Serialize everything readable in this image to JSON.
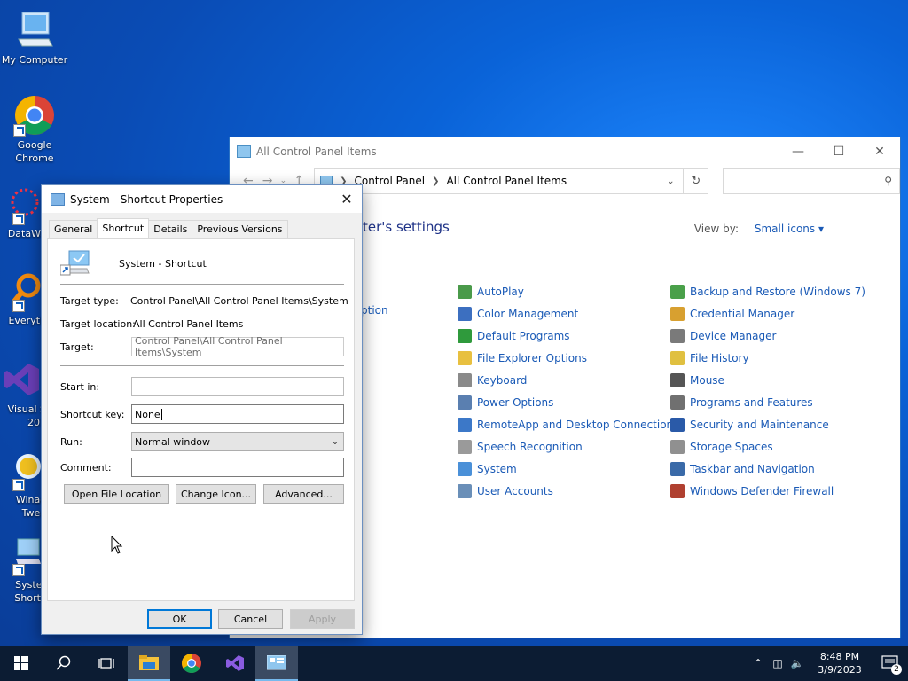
{
  "desktop": {
    "icons": [
      {
        "label": "My Computer",
        "icon": "monitor-icon"
      },
      {
        "label": "Google\nChrome",
        "icon": "chrome-icon"
      },
      {
        "label": "DataWa",
        "icon": "datawarrior-icon"
      },
      {
        "label": "Everyth",
        "icon": "everything-search-icon"
      },
      {
        "label": "Visual S\n201",
        "icon": "visual-studio-icon"
      },
      {
        "label": "Winae\nTwea",
        "icon": "winaero-tweaker-icon"
      },
      {
        "label": "Syster\nShortc",
        "icon": "system-shortcut-icon"
      }
    ]
  },
  "control_panel": {
    "title": "All Control Panel Items",
    "address": [
      "Control Panel",
      "All Control Panel Items"
    ],
    "heading": "ter's settings",
    "view_by_label": "View by:",
    "view_by_value": "Small icons",
    "partial_left": "ption",
    "columns": [
      [
        {
          "label": "AutoPlay",
          "color": "#4a9a4a"
        },
        {
          "label": "Color Management",
          "color": "#3c6fc0"
        },
        {
          "label": "Default Programs",
          "color": "#2f9a3c"
        },
        {
          "label": "File Explorer Options",
          "color": "#e8c040"
        },
        {
          "label": "Keyboard",
          "color": "#8a8a8a"
        },
        {
          "label": "Power Options",
          "color": "#5a7fb0"
        },
        {
          "label": "RemoteApp and Desktop Connections",
          "color": "#3c78c8"
        },
        {
          "label": "Speech Recognition",
          "color": "#9a9a9a"
        },
        {
          "label": "System",
          "color": "#4a90d8"
        },
        {
          "label": "User Accounts",
          "color": "#6a8fb8"
        }
      ],
      [
        {
          "label": "Backup and Restore (Windows 7)",
          "color": "#4aa04a"
        },
        {
          "label": "Credential Manager",
          "color": "#d8a030"
        },
        {
          "label": "Device Manager",
          "color": "#7a7a7a"
        },
        {
          "label": "File History",
          "color": "#e0c040"
        },
        {
          "label": "Mouse",
          "color": "#555555"
        },
        {
          "label": "Programs and Features",
          "color": "#707070"
        },
        {
          "label": "Security and Maintenance",
          "color": "#2a5aa8"
        },
        {
          "label": "Storage Spaces",
          "color": "#909090"
        },
        {
          "label": "Taskbar and Navigation",
          "color": "#3a6aa8"
        },
        {
          "label": "Windows Defender Firewall",
          "color": "#b04030"
        }
      ]
    ]
  },
  "dialog": {
    "title": "System - Shortcut Properties",
    "tabs": [
      "General",
      "Shortcut",
      "Details",
      "Previous Versions"
    ],
    "active_tab": "Shortcut",
    "name": "System - Shortcut",
    "target_type_label": "Target type:",
    "target_type_value": "Control Panel\\All Control Panel Items\\System",
    "target_location_label": "Target location:",
    "target_location_value": "All Control Panel Items",
    "target_label": "Target:",
    "target_value": "Control Panel\\All Control Panel Items\\System",
    "start_in_label": "Start in:",
    "start_in_value": "",
    "shortcut_key_label": "Shortcut key:",
    "shortcut_key_value": "None",
    "run_label": "Run:",
    "run_value": "Normal window",
    "comment_label": "Comment:",
    "comment_value": "",
    "open_file_location": "Open File Location",
    "change_icon": "Change Icon...",
    "advanced": "Advanced...",
    "ok": "OK",
    "cancel": "Cancel",
    "apply": "Apply"
  },
  "taskbar": {
    "time": "8:48 PM",
    "date": "3/9/2023",
    "notification_count": "2"
  }
}
